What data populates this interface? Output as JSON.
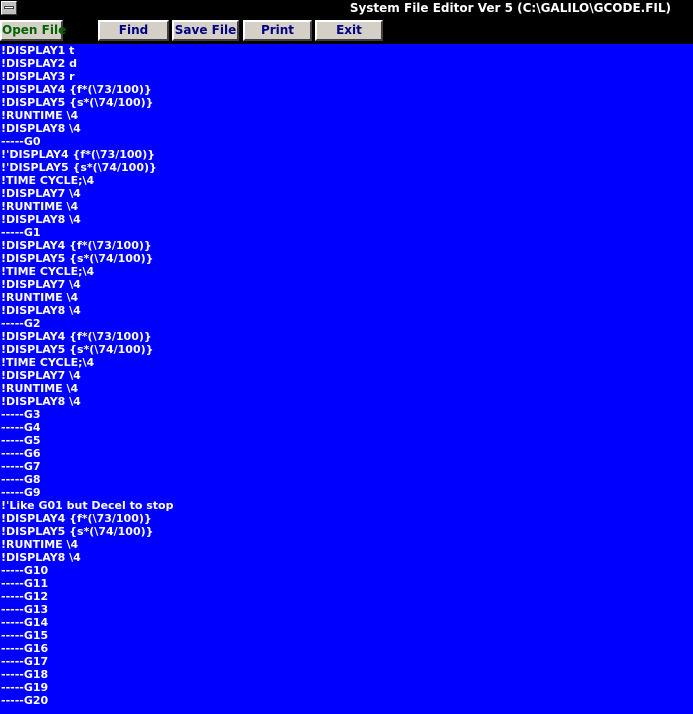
{
  "window": {
    "title": "System File Editor Ver 5  (C:\\GALILO\\GCODE.FIL)"
  },
  "colors": {
    "editor_background": "#0000ff",
    "editor_text": "#ffffff",
    "title_background": "#000000",
    "button_face": "#d4d0c8",
    "open_label": "#006400",
    "button_label": "#000080"
  },
  "toolbar": {
    "open_label": "Open File",
    "find_label": "Find",
    "save_label": "Save File",
    "print_label": "Print",
    "exit_label": "Exit"
  },
  "editor": {
    "lines": [
      "!DISPLAY1 t",
      "!DISPLAY2 d",
      "!DISPLAY3 r",
      "!DISPLAY4 {f*(\\73/100)}",
      "!DISPLAY5 {s*(\\74/100)}",
      "!RUNTIME \\4",
      "!DISPLAY8 \\4",
      "-----G0",
      "!'DISPLAY4 {f*(\\73/100)}",
      "!'DISPLAY5 {s*(\\74/100)}",
      "!TIME CYCLE;\\4",
      "!DISPLAY7 \\4",
      "!RUNTIME \\4",
      "!DISPLAY8 \\4",
      "-----G1",
      "!DISPLAY4 {f*(\\73/100)}",
      "!DISPLAY5 {s*(\\74/100)}",
      "!TIME CYCLE;\\4",
      "!DISPLAY7 \\4",
      "!RUNTIME \\4",
      "!DISPLAY8 \\4",
      "-----G2",
      "!DISPLAY4 {f*(\\73/100)}",
      "!DISPLAY5 {s*(\\74/100)}",
      "!TIME CYCLE;\\4",
      "!DISPLAY7 \\4",
      "!RUNTIME \\4",
      "!DISPLAY8 \\4",
      "-----G3",
      "-----G4",
      "-----G5",
      "-----G6",
      "-----G7",
      "-----G8",
      "-----G9",
      "!'Like G01 but Decel to stop",
      "!DISPLAY4 {f*(\\73/100)}",
      "!DISPLAY5 {s*(\\74/100)}",
      "!RUNTIME \\4",
      "!DISPLAY8 \\4",
      "-----G10",
      "-----G11",
      "-----G12",
      "-----G13",
      "-----G14",
      "-----G15",
      "-----G16",
      "-----G17",
      "-----G18",
      "-----G19",
      "-----G20"
    ]
  }
}
